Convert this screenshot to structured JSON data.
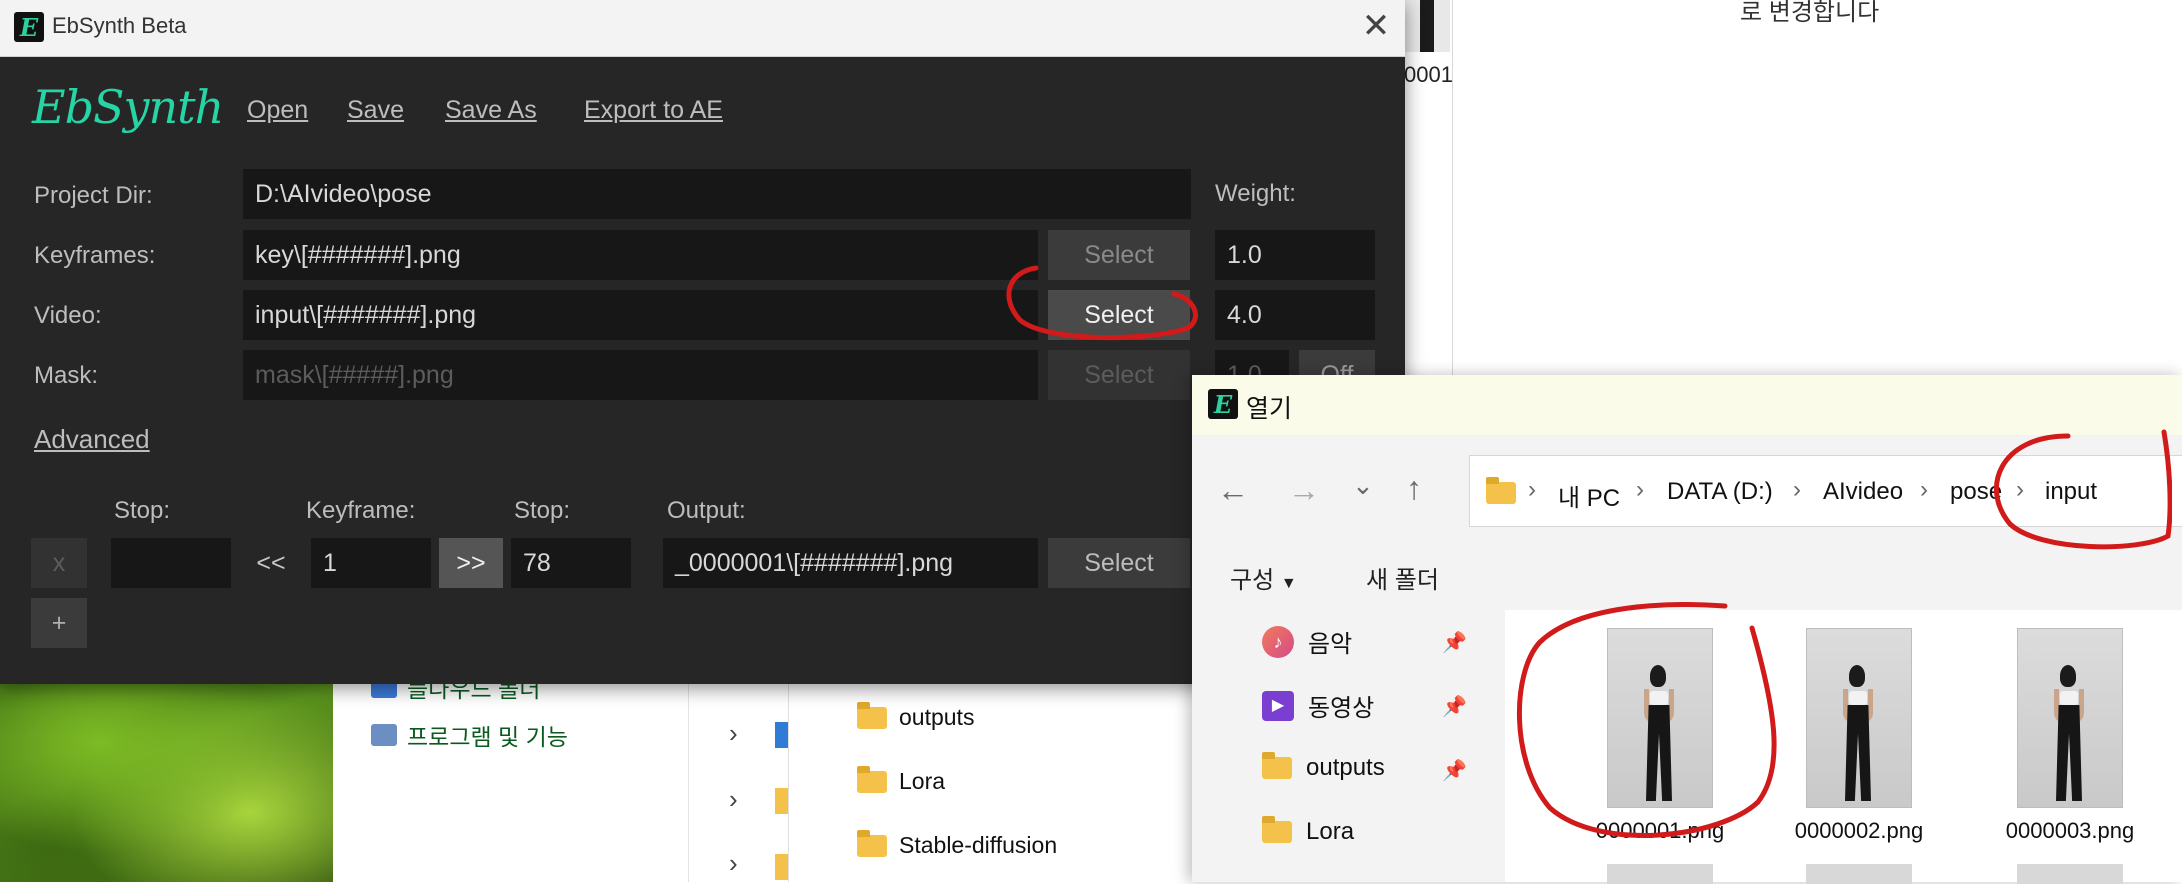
{
  "background": {
    "left_panel": {
      "items": [
        {
          "label": "플다우드 폴더"
        },
        {
          "label": "프로그램 및 기능"
        }
      ]
    },
    "middle_panel": {
      "folders": [
        {
          "label": "outputs"
        },
        {
          "label": "Lora"
        },
        {
          "label": "Stable-diffusion"
        }
      ]
    },
    "document": {
      "text": "로 변경합니다",
      "thumb_label": "0001"
    }
  },
  "ebsynth": {
    "title": "EbSynth Beta",
    "logo": "EbSynth",
    "menu": [
      "Open",
      "Save",
      "Save As",
      "Export to AE"
    ],
    "project_dir_label": "Project Dir:",
    "project_dir": "D:\\AIvideo\\pose",
    "weight_label": "Weight:",
    "rows": [
      {
        "label": "Keyframes:",
        "value": "key\\[#######].png",
        "button": "Select",
        "weight": "1.0"
      },
      {
        "label": "Video:",
        "value": "input\\[#######].png",
        "button": "Select",
        "weight": "4.0"
      },
      {
        "label": "Mask:",
        "value": "mask\\[#####].png",
        "button": "Select",
        "weight": "1.0",
        "toggle": "Off"
      }
    ],
    "advanced_label": "Advanced",
    "keyframe_row": {
      "stop_label": "Stop:",
      "keyframe_label": "Keyframe:",
      "stop2_label": "Stop:",
      "output_label": "Output:",
      "remove_btn": "x",
      "stop_value": "",
      "prev_btn": "<<",
      "keyframe_value": "1",
      "next_btn": ">>",
      "stop2_value": "78",
      "output_value": "_0000001\\[#######].png",
      "select_btn": "Select",
      "add_btn": "+"
    },
    "accent_color": "#26d4a6"
  },
  "dialog": {
    "title": "열기",
    "breadcrumb": [
      "내 PC",
      "DATA (D:)",
      "AIvideo",
      "pose",
      "input"
    ],
    "commands": {
      "organize": "구성",
      "new_folder": "새 폴더"
    },
    "nav_items": [
      {
        "label": "음악",
        "icon": "music-icon"
      },
      {
        "label": "동영상",
        "icon": "video-icon"
      },
      {
        "label": "outputs",
        "icon": "folder-icon"
      },
      {
        "label": "Lora",
        "icon": "folder-icon"
      }
    ],
    "files": [
      {
        "name": "0000001.png"
      },
      {
        "name": "0000002.png"
      },
      {
        "name": "0000003.png"
      }
    ]
  },
  "annotation_color": "#d11a1a"
}
